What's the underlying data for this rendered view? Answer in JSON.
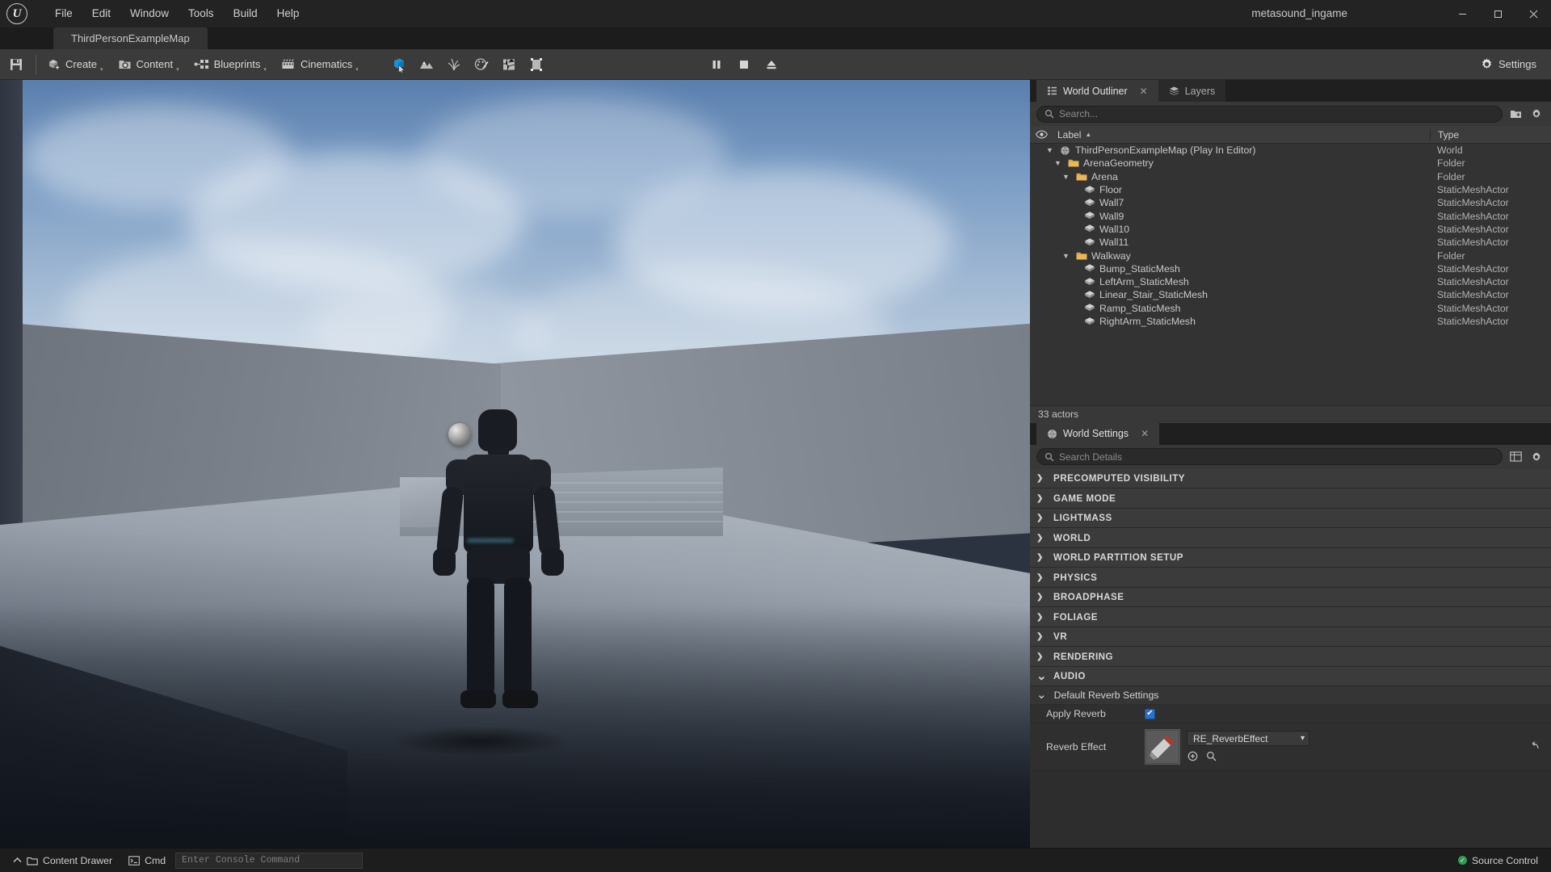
{
  "titlebar": {
    "logo": "unreal-engine-logo",
    "menus": [
      "File",
      "Edit",
      "Window",
      "Tools",
      "Build",
      "Help"
    ],
    "document_name": "metasound_ingame",
    "window_controls": {
      "minimize": "—",
      "maximize": "□",
      "close": "✕"
    }
  },
  "level_tab": {
    "label": "ThirdPersonExampleMap"
  },
  "toolbar": {
    "save_tooltip": "Save",
    "buttons": [
      {
        "label": "Create",
        "icon": "create-icon"
      },
      {
        "label": "Content",
        "icon": "content-icon"
      },
      {
        "label": "Blueprints",
        "icon": "blueprints-icon"
      },
      {
        "label": "Cinematics",
        "icon": "cinematics-icon"
      }
    ],
    "modes": [
      "select-mode-icon",
      "landscape-mode-icon",
      "foliage-mode-icon",
      "mesh-paint-mode-icon",
      "fracture-mode-icon",
      "brush-edit-mode-icon"
    ],
    "play_controls": [
      "pause-button",
      "stop-button",
      "eject-button"
    ],
    "settings_label": "Settings",
    "accent_color": "#1d8fd4"
  },
  "outliner": {
    "tabs": [
      {
        "label": "World Outliner",
        "active": true,
        "closable": true,
        "icon": "outliner-icon"
      },
      {
        "label": "Layers",
        "active": false,
        "closable": false,
        "icon": "layers-icon"
      }
    ],
    "search_placeholder": "Search...",
    "columns": {
      "label": "Label",
      "type": "Type",
      "sort_indicator": "▲"
    },
    "rows": [
      {
        "label": "ThirdPersonExampleMap (Play In Editor)",
        "type": "World",
        "depth": 1,
        "twisty": "down",
        "icon": "world-icon"
      },
      {
        "label": "ArenaGeometry",
        "type": "Folder",
        "depth": 2,
        "twisty": "down",
        "icon": "folder-icon"
      },
      {
        "label": "Arena",
        "type": "Folder",
        "depth": 3,
        "twisty": "down",
        "icon": "folder-icon"
      },
      {
        "label": "Floor",
        "type": "StaticMeshActor",
        "depth": 4,
        "twisty": "",
        "icon": "mesh-icon"
      },
      {
        "label": "Wall7",
        "type": "StaticMeshActor",
        "depth": 4,
        "twisty": "",
        "icon": "mesh-icon"
      },
      {
        "label": "Wall9",
        "type": "StaticMeshActor",
        "depth": 4,
        "twisty": "",
        "icon": "mesh-icon"
      },
      {
        "label": "Wall10",
        "type": "StaticMeshActor",
        "depth": 4,
        "twisty": "",
        "icon": "mesh-icon"
      },
      {
        "label": "Wall11",
        "type": "StaticMeshActor",
        "depth": 4,
        "twisty": "",
        "icon": "mesh-icon"
      },
      {
        "label": "Walkway",
        "type": "Folder",
        "depth": 3,
        "twisty": "down",
        "icon": "folder-icon"
      },
      {
        "label": "Bump_StaticMesh",
        "type": "StaticMeshActor",
        "depth": 4,
        "twisty": "",
        "icon": "mesh-icon"
      },
      {
        "label": "LeftArm_StaticMesh",
        "type": "StaticMeshActor",
        "depth": 4,
        "twisty": "",
        "icon": "mesh-icon"
      },
      {
        "label": "Linear_Stair_StaticMesh",
        "type": "StaticMeshActor",
        "depth": 4,
        "twisty": "",
        "icon": "mesh-icon"
      },
      {
        "label": "Ramp_StaticMesh",
        "type": "StaticMeshActor",
        "depth": 4,
        "twisty": "",
        "icon": "mesh-icon"
      },
      {
        "label": "RightArm_StaticMesh",
        "type": "StaticMeshActor",
        "depth": 4,
        "twisty": "",
        "icon": "mesh-icon"
      }
    ],
    "status": "33 actors"
  },
  "world_settings": {
    "tab": {
      "label": "World Settings",
      "icon": "world-settings-icon",
      "closable": true
    },
    "search_placeholder": "Search Details",
    "categories": [
      {
        "label": "PRECOMPUTED VISIBILITY",
        "expanded": false
      },
      {
        "label": "GAME MODE",
        "expanded": false
      },
      {
        "label": "LIGHTMASS",
        "expanded": false
      },
      {
        "label": "WORLD",
        "expanded": false
      },
      {
        "label": "WORLD PARTITION SETUP",
        "expanded": false
      },
      {
        "label": "PHYSICS",
        "expanded": false
      },
      {
        "label": "BROADPHASE",
        "expanded": false
      },
      {
        "label": "FOLIAGE",
        "expanded": false
      },
      {
        "label": "VR",
        "expanded": false
      },
      {
        "label": "RENDERING",
        "expanded": false
      },
      {
        "label": "AUDIO",
        "expanded": true
      }
    ],
    "audio": {
      "group_label": "Default Reverb Settings",
      "apply_reverb": {
        "label": "Apply Reverb",
        "checked": true,
        "check_glyph": "✔"
      },
      "reverb_effect": {
        "label": "Reverb Effect",
        "value": "RE_ReverbEffect",
        "caret": "▾",
        "browse_icon": "browse-icon",
        "search_icon": "magnifier-icon",
        "reset_icon": "reset-arrow-icon",
        "thumbnail": "reverb-asset-thumbnail"
      }
    }
  },
  "statusbar": {
    "content_drawer": "Content Drawer",
    "cmd_label": "Cmd",
    "console_placeholder": "Enter Console Command",
    "source_control": "Source Control",
    "source_control_ok_glyph": "✓"
  }
}
